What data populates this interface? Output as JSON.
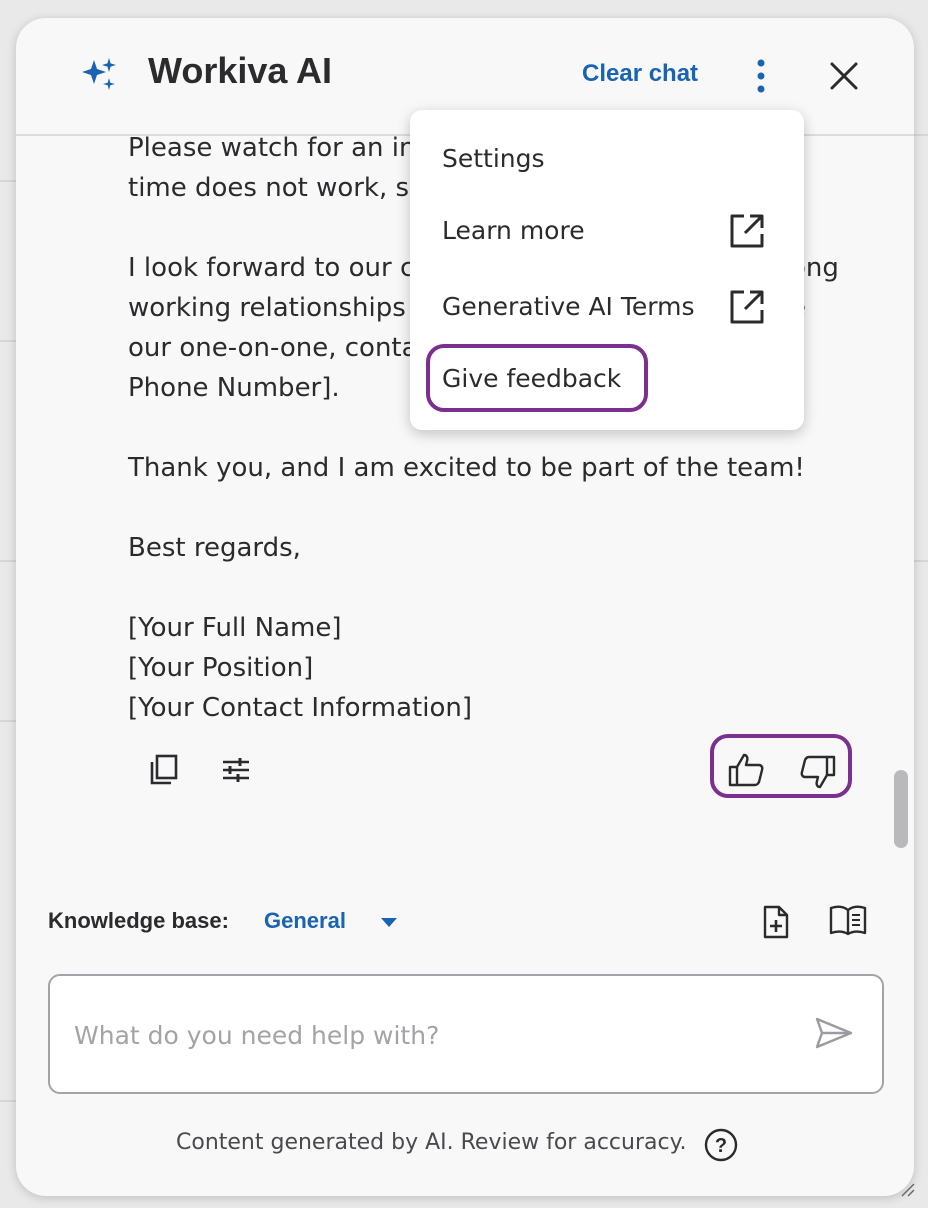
{
  "header": {
    "title": "Workiva AI",
    "clear_chat": "Clear chat",
    "icons": [
      "sparkle-icon",
      "kebab-menu-icon",
      "close-icon"
    ]
  },
  "message": {
    "lines": [
      "Please watch for an in",
      "time does not work, su",
      "",
      "I look forward to our c",
      "working relationships",
      "our one-on-one, conta",
      "Phone Number].",
      "",
      "Thank you, and I am excited to be part of the team!",
      "",
      "Best regards,",
      "",
      "[Your Full Name]",
      "[Your Position]",
      "[Your Contact Information]"
    ],
    "right_fragments": [
      "ong",
      "e"
    ]
  },
  "menu": {
    "items": [
      "Settings",
      "Learn more",
      "Generative AI Terms",
      "Give feedback"
    ]
  },
  "knowledge_base": {
    "label": "Knowledge base:",
    "value": "General"
  },
  "input": {
    "placeholder": "What do you need help with?",
    "value": ""
  },
  "footer": {
    "disclaimer": "Content generated by AI. Review for accuracy."
  },
  "colors": {
    "accent": "#1a63b3",
    "highlight": "#7b2f8e",
    "text": "#2b2b2e"
  }
}
